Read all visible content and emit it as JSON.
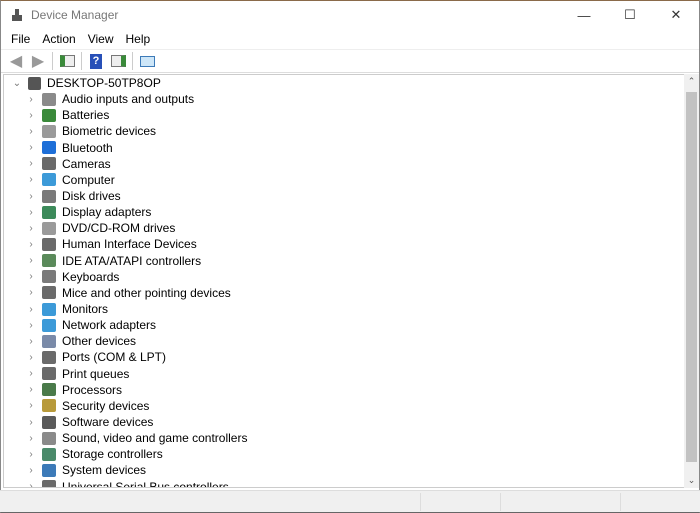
{
  "window": {
    "title": "Device Manager",
    "controls": [
      "minimize",
      "maximize",
      "close"
    ]
  },
  "menu": [
    "File",
    "Action",
    "View",
    "Help"
  ],
  "toolbar": [
    "back-icon",
    "forward-icon",
    "show-hide-console-tree-icon",
    "help-icon",
    "properties-icon",
    "scan-hardware-icon"
  ],
  "tree": {
    "root": "DESKTOP-50TP8OP",
    "items": [
      {
        "label": "Audio inputs and outputs",
        "icon": "speaker-icon",
        "color": "#8a8a8a"
      },
      {
        "label": "Batteries",
        "icon": "battery-icon",
        "color": "#3a8a3a"
      },
      {
        "label": "Biometric devices",
        "icon": "fingerprint-icon",
        "color": "#9a9a9a"
      },
      {
        "label": "Bluetooth",
        "icon": "bluetooth-icon",
        "color": "#1e6fd8"
      },
      {
        "label": "Cameras",
        "icon": "camera-icon",
        "color": "#6a6a6a"
      },
      {
        "label": "Computer",
        "icon": "computer-icon",
        "color": "#3c9ad8"
      },
      {
        "label": "Disk drives",
        "icon": "disk-drive-icon",
        "color": "#7a7a7a"
      },
      {
        "label": "Display adapters",
        "icon": "display-adapter-icon",
        "color": "#3c8a5a"
      },
      {
        "label": "DVD/CD-ROM drives",
        "icon": "dvd-icon",
        "color": "#9a9a9a"
      },
      {
        "label": "Human Interface Devices",
        "icon": "hid-icon",
        "color": "#6a6a6a"
      },
      {
        "label": "IDE ATA/ATAPI controllers",
        "icon": "ide-controller-icon",
        "color": "#5a8a5a"
      },
      {
        "label": "Keyboards",
        "icon": "keyboard-icon",
        "color": "#7a7a7a"
      },
      {
        "label": "Mice and other pointing devices",
        "icon": "mouse-icon",
        "color": "#6a6a6a"
      },
      {
        "label": "Monitors",
        "icon": "monitor-icon",
        "color": "#3c9ad8"
      },
      {
        "label": "Network adapters",
        "icon": "network-adapter-icon",
        "color": "#3c9ad8"
      },
      {
        "label": "Other devices",
        "icon": "unknown-device-icon",
        "color": "#7a8aa8"
      },
      {
        "label": "Ports (COM & LPT)",
        "icon": "port-icon",
        "color": "#6a6a6a"
      },
      {
        "label": "Print queues",
        "icon": "printer-icon",
        "color": "#6a6a6a"
      },
      {
        "label": "Processors",
        "icon": "processor-icon",
        "color": "#4a7a4a"
      },
      {
        "label": "Security devices",
        "icon": "security-key-icon",
        "color": "#b89a3a"
      },
      {
        "label": "Software devices",
        "icon": "software-device-icon",
        "color": "#5a5a5a"
      },
      {
        "label": "Sound, video and game controllers",
        "icon": "sound-icon",
        "color": "#8a8a8a"
      },
      {
        "label": "Storage controllers",
        "icon": "storage-controller-icon",
        "color": "#4a8a6a"
      },
      {
        "label": "System devices",
        "icon": "system-devices-icon",
        "color": "#3c7ab8"
      },
      {
        "label": "Universal Serial Bus controllers",
        "icon": "usb-icon",
        "color": "#6a6a6a"
      }
    ]
  }
}
